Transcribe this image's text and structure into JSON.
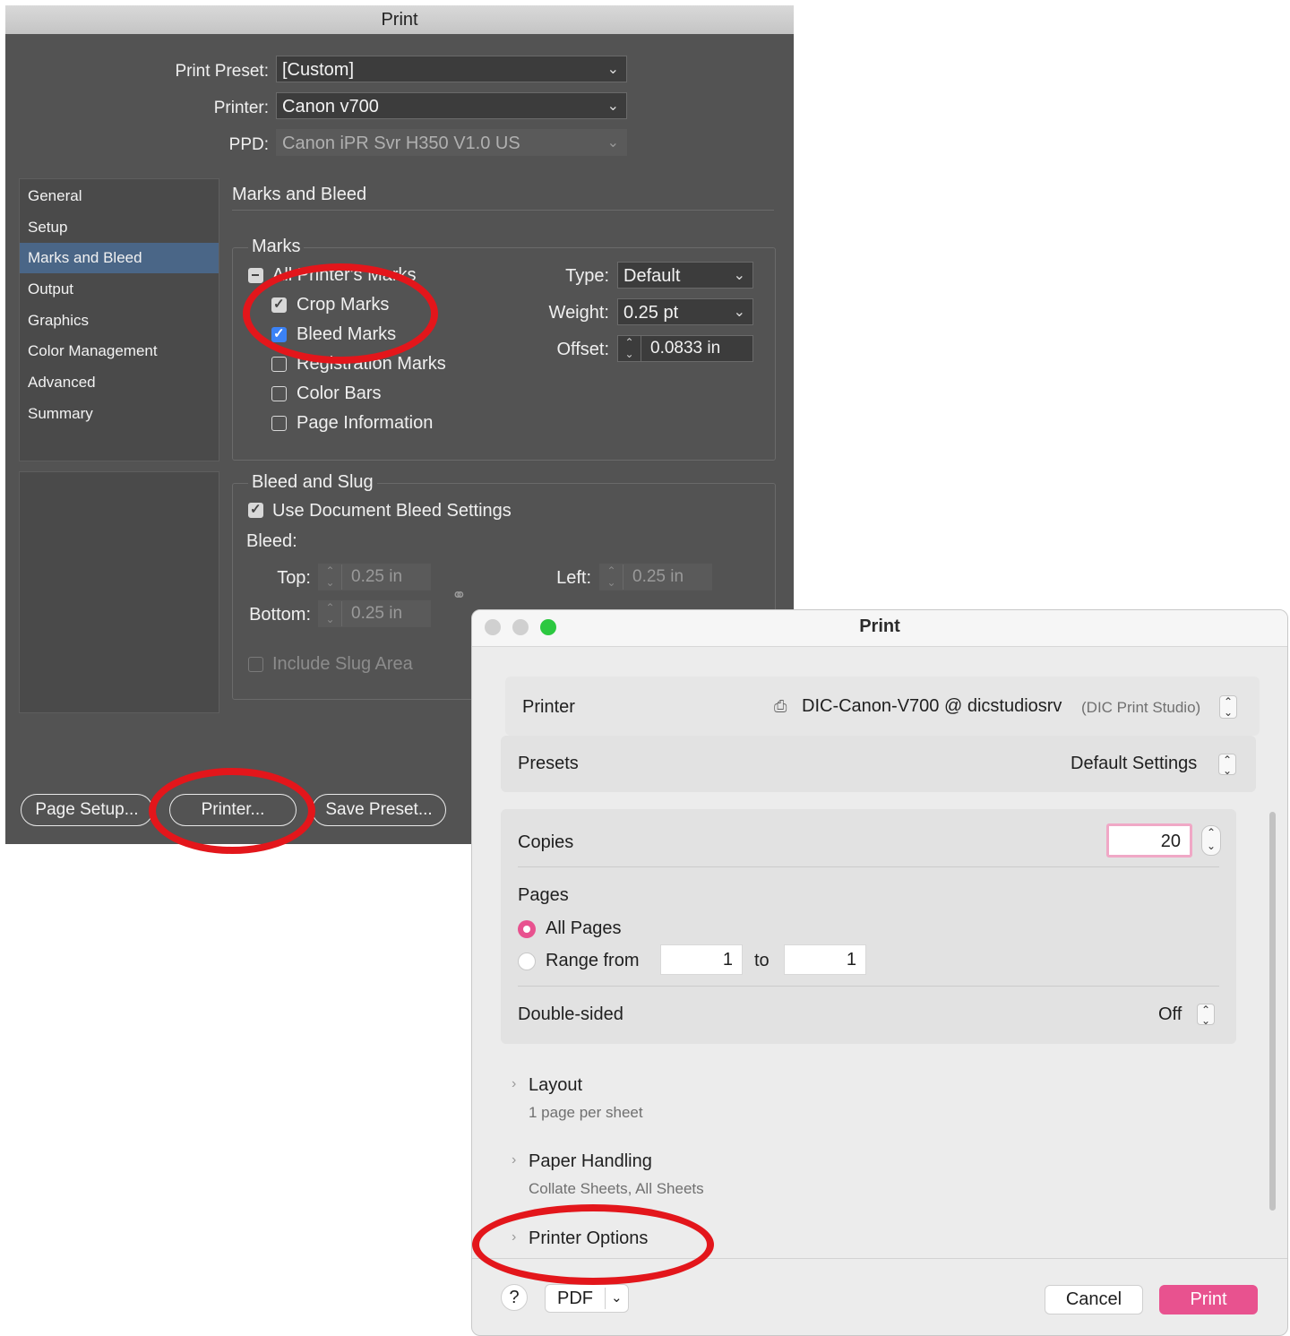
{
  "indesign": {
    "title": "Print",
    "print_preset_label": "Print Preset:",
    "print_preset_value": "[Custom]",
    "printer_label": "Printer:",
    "printer_value": "Canon v700",
    "ppd_label": "PPD:",
    "ppd_value": "Canon iPR Svr H350 V1.0 US",
    "nav": [
      "General",
      "Setup",
      "Marks and Bleed",
      "Output",
      "Graphics",
      "Color Management",
      "Advanced",
      "Summary"
    ],
    "selected_nav": "Marks and Bleed",
    "section_title": "Marks and Bleed",
    "marks": {
      "group_label": "Marks",
      "all_printers_marks": "All Printer's Marks",
      "crop_marks": "Crop Marks",
      "bleed_marks": "Bleed Marks",
      "registration_marks": "Registration Marks",
      "color_bars": "Color Bars",
      "page_information": "Page Information",
      "type_label": "Type:",
      "type_value": "Default",
      "weight_label": "Weight:",
      "weight_value": "0.25 pt",
      "offset_label": "Offset:",
      "offset_value": "0.0833 in"
    },
    "bleed": {
      "group_label": "Bleed and Slug",
      "use_document": "Use Document Bleed Settings",
      "bleed_label": "Bleed:",
      "top_label": "Top:",
      "top_value": "0.25 in",
      "bottom_label": "Bottom:",
      "bottom_value": "0.25 in",
      "left_label": "Left:",
      "left_value": "0.25 in",
      "include_slug": "Include Slug Area"
    },
    "buttons": {
      "page_setup": "Page Setup...",
      "printer": "Printer...",
      "save_preset": "Save Preset..."
    }
  },
  "mac_print": {
    "title": "Print",
    "printer_label": "Printer",
    "printer_value": "DIC-Canon-V700 @ dicstudiosrv",
    "printer_location": "(DIC Print Studio)",
    "presets_label": "Presets",
    "presets_value": "Default Settings",
    "copies_label": "Copies",
    "copies_value": "20",
    "pages_label": "Pages",
    "all_pages": "All Pages",
    "range_from": "Range from",
    "range_start": "1",
    "range_to": "to",
    "range_end": "1",
    "double_sided_label": "Double-sided",
    "double_sided_value": "Off",
    "layout_title": "Layout",
    "layout_sub": "1 page per sheet",
    "paper_title": "Paper Handling",
    "paper_sub": "Collate Sheets, All Sheets",
    "printer_options": "Printer Options",
    "help": "?",
    "pdf": "PDF",
    "cancel": "Cancel",
    "print": "Print"
  },
  "colors": {
    "indesign_bg": "#535353",
    "nav_selected": "#4a6687",
    "accent_pink": "#e8528f",
    "annotation_red": "#e3161b"
  },
  "icons": [
    "chevron-down-icon",
    "checkbox-icon",
    "stepper-icon",
    "chain-link-icon",
    "printer-icon",
    "up-down-chevron-icon",
    "disclosure-chevron-icon"
  ]
}
